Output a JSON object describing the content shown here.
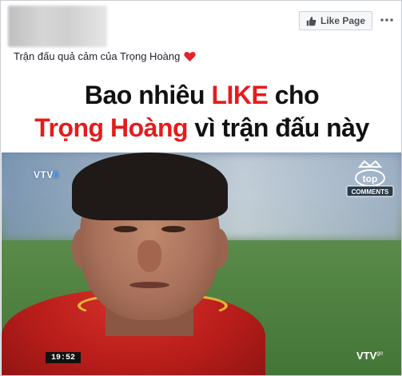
{
  "post": {
    "like_page_label": "Like Page",
    "caption": "Trận đấu quả cảm của Trọng Hoàng"
  },
  "banner": {
    "line1_prefix": "Bao nhiêu ",
    "line1_highlight": "LIKE",
    "line1_suffix": " cho",
    "line2_highlight": "Trọng Hoàng",
    "line2_suffix": " vì trận đấu này"
  },
  "video": {
    "channel_logo": "VTV",
    "channel_number": "6",
    "timestamp": "19:52",
    "watermark": "VTV",
    "watermark_suffix": "go",
    "corner_logo_top": "top",
    "corner_logo_bottom": "COMMENTS"
  },
  "colors": {
    "accent_red": "#e41c1c",
    "heart": "#e0242b",
    "facebook_gray": "#4b4f56"
  },
  "icons": {
    "like_button_icon": "thumbs-up-icon",
    "menu_icon": "more-dots-icon",
    "caption_icon": "red-heart-icon"
  }
}
